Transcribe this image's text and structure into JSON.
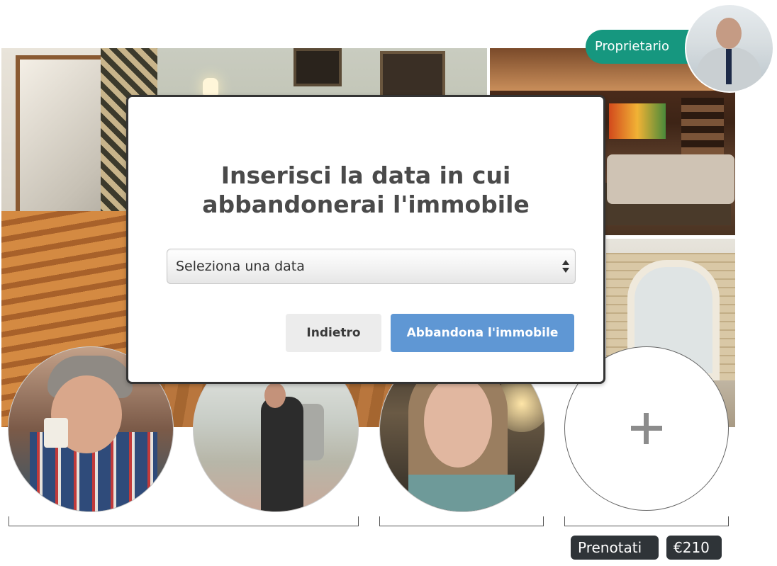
{
  "owner": {
    "badge_label": "Proprietario",
    "badge_color": "#16977f"
  },
  "photos": [
    {
      "name": "main-interior-photo"
    },
    {
      "name": "living-room-photo"
    },
    {
      "name": "bathroom-arch-photo"
    }
  ],
  "guests": [
    {
      "name": "guest-avatar-1"
    },
    {
      "name": "guest-avatar-2"
    },
    {
      "name": "guest-avatar-3"
    }
  ],
  "add_slot": {
    "icon": "plus-icon"
  },
  "status": {
    "booked_label": "Prenotati",
    "price": "€210"
  },
  "modal": {
    "title_line1": "Inserisci la data in cui",
    "title_line2": "abbandonerai l'immobile",
    "select": {
      "selected_value": "Seleziona una data",
      "icon": "sort-arrows-icon"
    },
    "back_button": "Indietro",
    "leave_button": "Abbandona l'immobile",
    "accent_color": "#5f97d4"
  }
}
